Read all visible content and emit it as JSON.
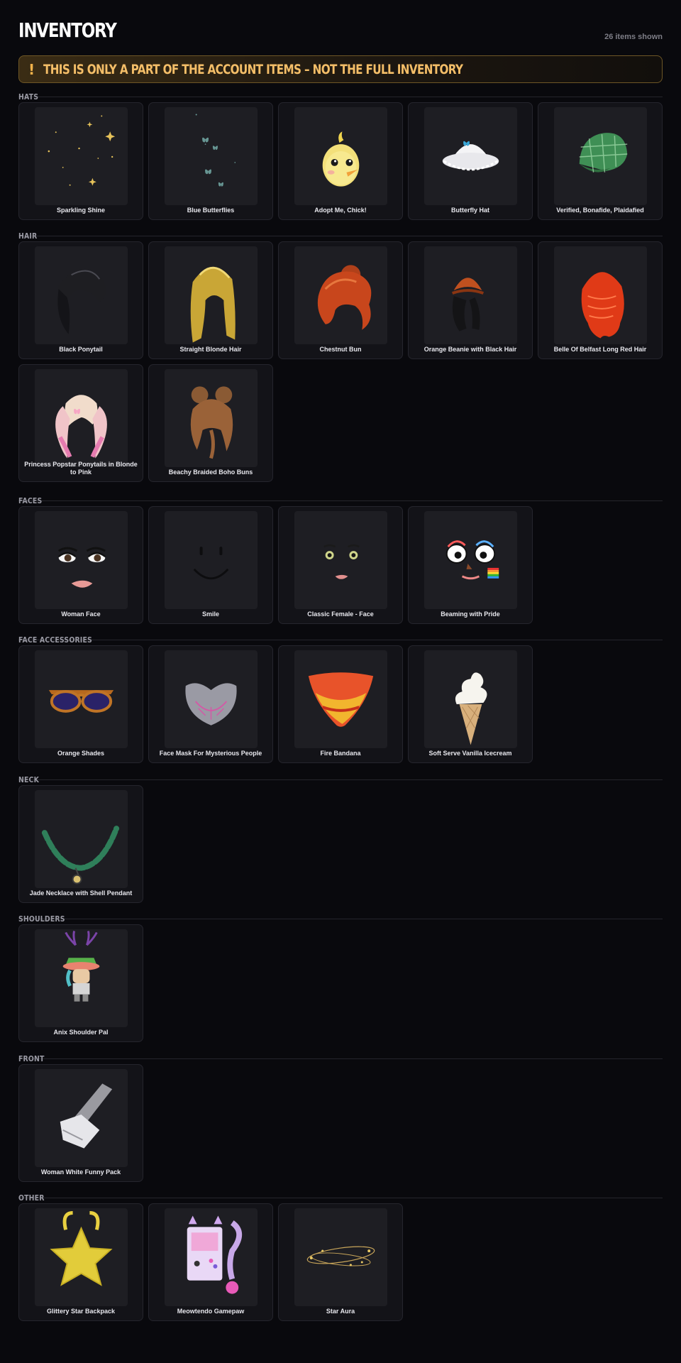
{
  "title": "INVENTORY",
  "count_text": "26 items shown",
  "banner": {
    "icon": "exclamation-icon",
    "icon_glyph": "!",
    "text": "THIS IS ONLY A PART OF THE ACCOUNT ITEMS – NOT THE FULL INVENTORY"
  },
  "colors": {
    "background": "#09090d",
    "card": "#131318",
    "banner_text": "#f4be68",
    "banner_border": "#6e5626"
  },
  "sections": [
    {
      "title": "HATS",
      "items": [
        {
          "name": "Sparkling Shine",
          "icon": "sparkle-icon"
        },
        {
          "name": "Blue Butterflies",
          "icon": "butterflies-icon"
        },
        {
          "name": "Adopt Me, Chick!",
          "icon": "chick-icon"
        },
        {
          "name": "Butterfly Hat",
          "icon": "bucket-hat-icon"
        },
        {
          "name": "Verified, Bonafide, Plaidafied",
          "icon": "plaid-cap-icon"
        }
      ]
    },
    {
      "title": "HAIR",
      "items": [
        {
          "name": "Black Ponytail",
          "icon": "black-hair-icon"
        },
        {
          "name": "Straight Blonde Hair",
          "icon": "blonde-hair-icon"
        },
        {
          "name": "Chestnut Bun",
          "icon": "chestnut-hair-icon"
        },
        {
          "name": "Orange Beanie with Black Hair",
          "icon": "beanie-hair-icon"
        },
        {
          "name": "Belle Of Belfast Long Red Hair",
          "icon": "red-hair-icon"
        },
        {
          "name": "Princess Popstar Ponytails in Blonde to Pink",
          "icon": "pink-ponytails-icon"
        },
        {
          "name": "Beachy Braided Boho Buns",
          "icon": "brown-buns-icon"
        }
      ]
    },
    {
      "title": "FACES",
      "items": [
        {
          "name": "Woman Face",
          "icon": "woman-face-icon"
        },
        {
          "name": "Smile",
          "icon": "smile-face-icon"
        },
        {
          "name": "Classic Female - Face",
          "icon": "classic-female-face-icon"
        },
        {
          "name": "Beaming with Pride",
          "icon": "pride-face-icon"
        }
      ]
    },
    {
      "title": "FACE ACCESSORIES",
      "items": [
        {
          "name": "Orange Shades",
          "icon": "shades-icon"
        },
        {
          "name": "Face Mask For Mysterious People",
          "icon": "face-mask-icon"
        },
        {
          "name": "Fire Bandana",
          "icon": "bandana-icon"
        },
        {
          "name": "Soft Serve Vanilla Icecream",
          "icon": "icecream-icon"
        }
      ]
    },
    {
      "title": "NECK",
      "items": [
        {
          "name": "Jade Necklace with Shell Pendant",
          "icon": "necklace-icon"
        }
      ]
    },
    {
      "title": "SHOULDERS",
      "items": [
        {
          "name": "Anix Shoulder Pal",
          "icon": "shoulder-pal-icon"
        }
      ]
    },
    {
      "title": "FRONT",
      "items": [
        {
          "name": "Woman White Funny Pack",
          "icon": "fanny-pack-icon"
        }
      ]
    },
    {
      "title": "OTHER",
      "items": [
        {
          "name": "Glittery Star Backpack",
          "icon": "star-backpack-icon"
        },
        {
          "name": "Meowtendo Gamepaw",
          "icon": "gamepaw-icon"
        },
        {
          "name": "Star Aura",
          "icon": "star-aura-icon"
        }
      ]
    }
  ]
}
